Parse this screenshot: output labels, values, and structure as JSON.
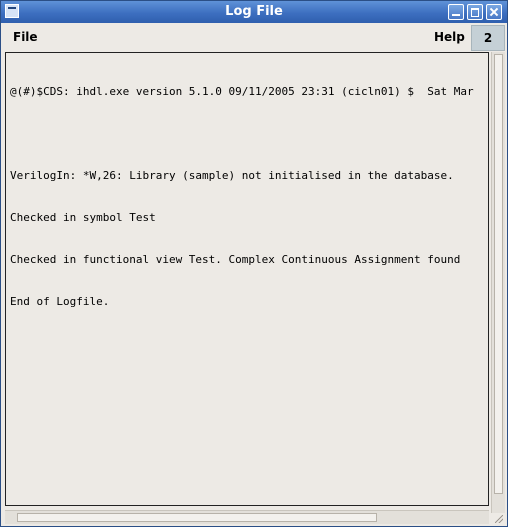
{
  "window": {
    "title": "Log File"
  },
  "menubar": {
    "file_label": "File",
    "help_label": "Help",
    "counter": "2"
  },
  "log": {
    "lines": [
      "@(#)$CDS: ihdl.exe version 5.1.0 09/11/2005 23:31 (cicln01) $  Sat Mar",
      "",
      "VerilogIn: *W,26: Library (sample) not initialised in the database.",
      "Checked in symbol Test",
      "Checked in functional view Test. Complex Continuous Assignment found",
      "End of Logfile."
    ]
  },
  "colors": {
    "titlebar": "#3d6fc0",
    "background": "#edeae5",
    "counter_box": "#c5d0d6"
  }
}
